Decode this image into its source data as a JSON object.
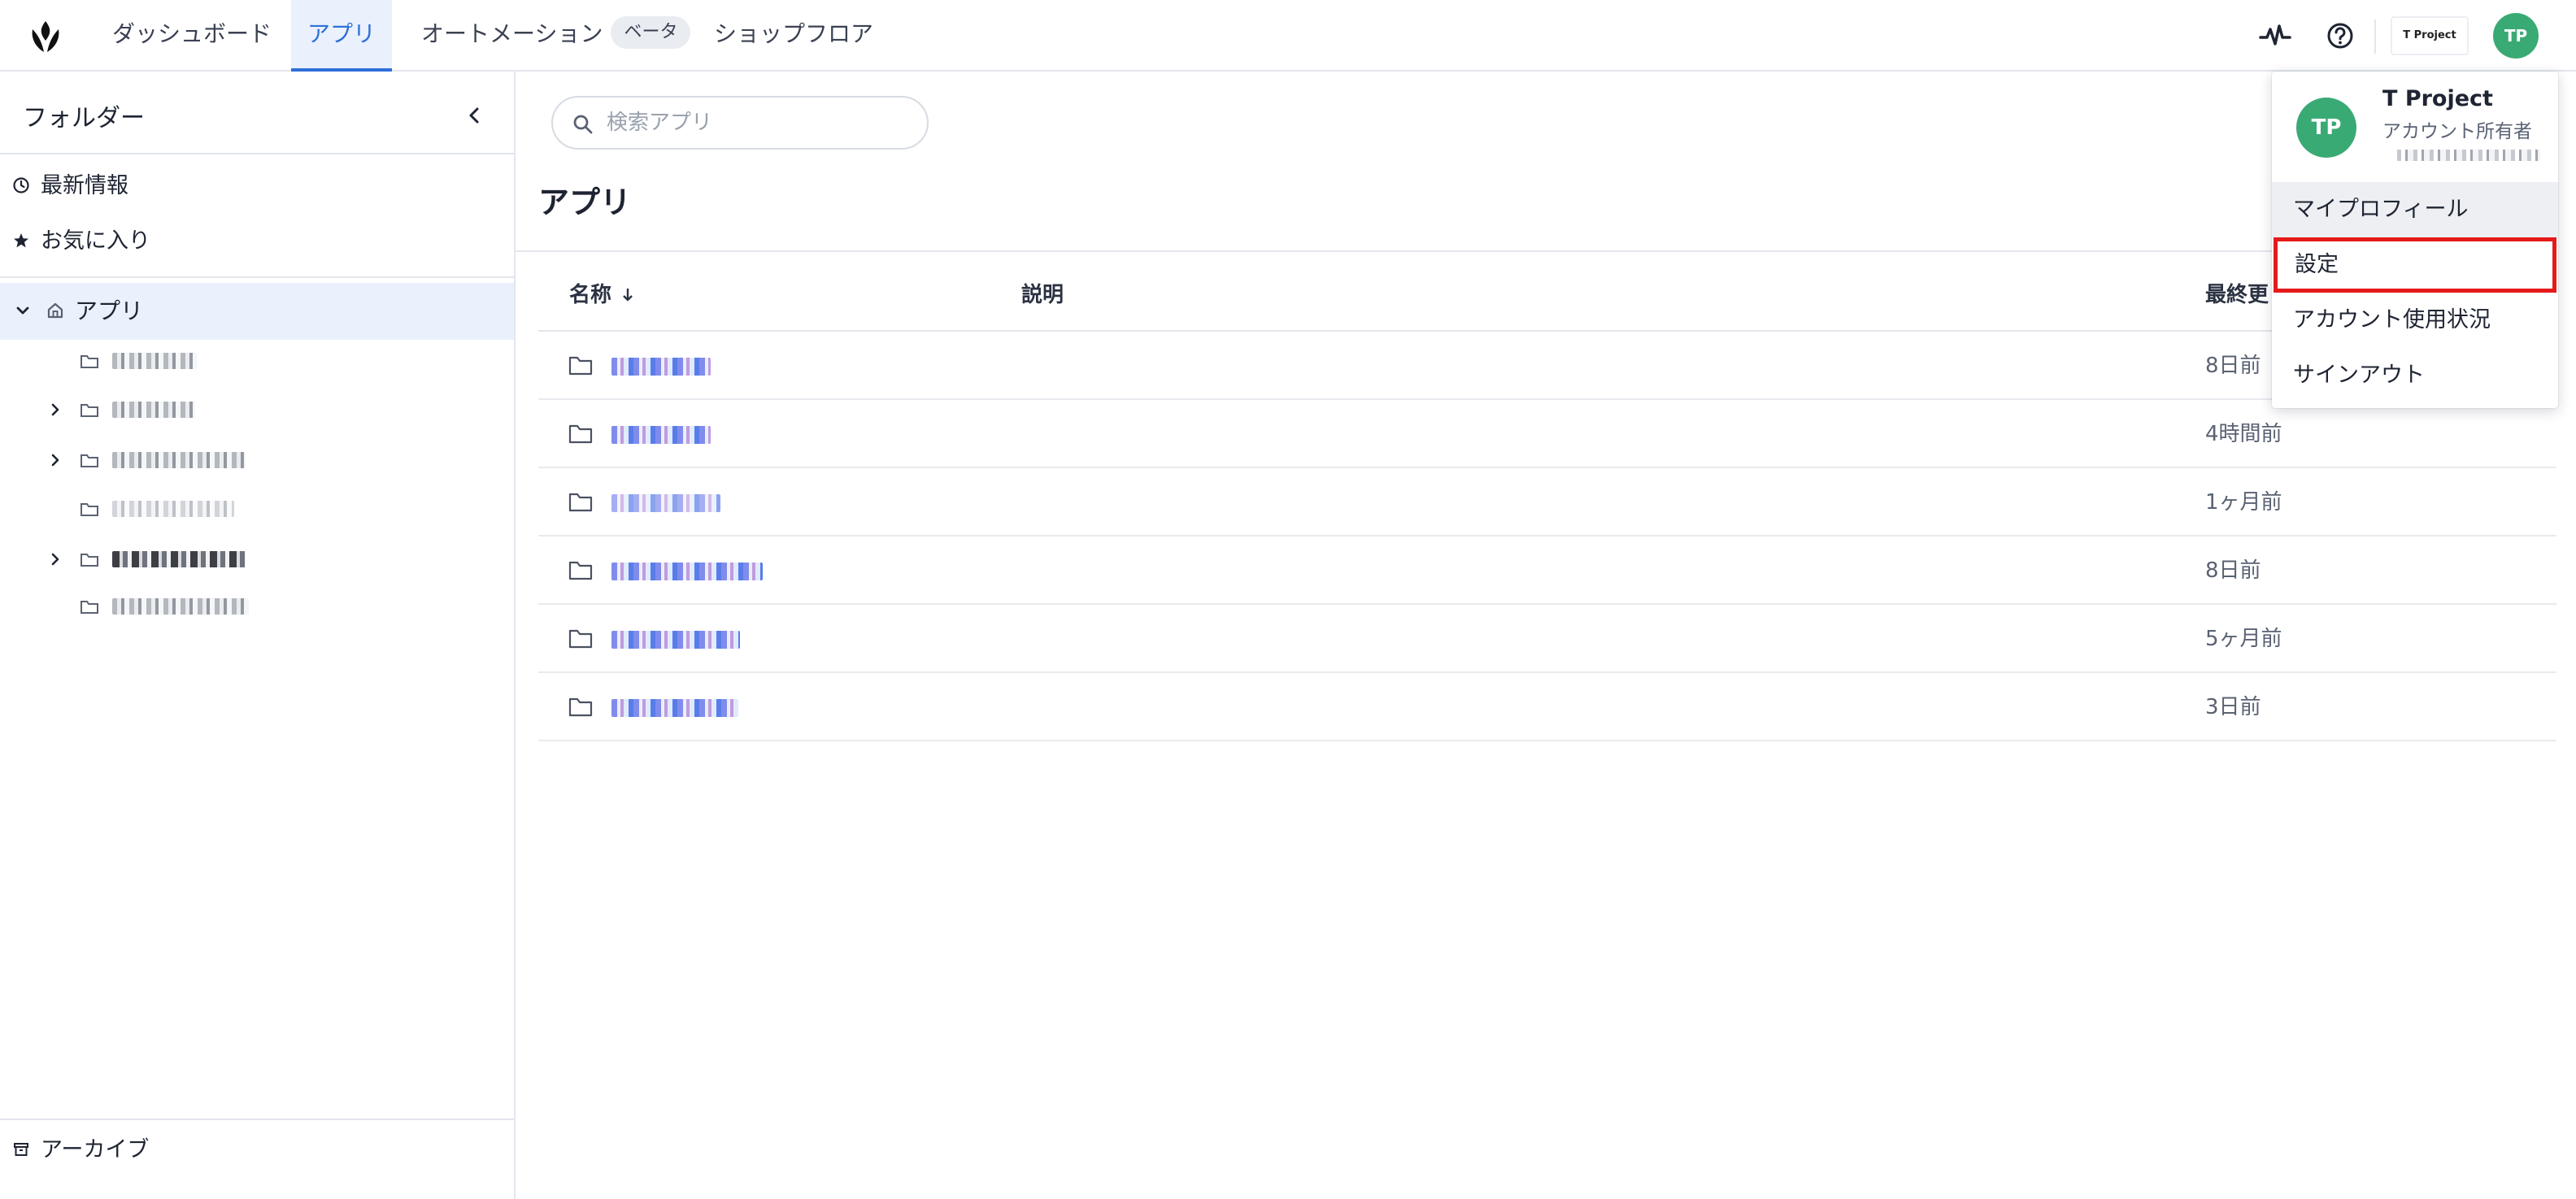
{
  "topbar": {
    "nav": [
      {
        "label": "ダッシュボード"
      },
      {
        "label": "アプリ",
        "active": true
      },
      {
        "label": "オートメーション",
        "badge": "ベータ"
      },
      {
        "label": "ショップフロア"
      }
    ],
    "brand_chip": "T Project",
    "avatar_initials": "TP"
  },
  "sidebar": {
    "title": "フォルダー",
    "links": [
      {
        "label": "最新情報",
        "icon": "clock-icon"
      },
      {
        "label": "お気に入り",
        "icon": "star-icon"
      }
    ],
    "apps_label": "アプリ",
    "archive_label": "アーカイブ"
  },
  "main": {
    "search_placeholder": "検索アプリ",
    "title": "アプリ",
    "columns": {
      "name": "名称",
      "description": "説明",
      "updated": "最終更"
    },
    "rows": [
      {
        "updated": "8日前"
      },
      {
        "updated": "4時間前"
      },
      {
        "updated": "1ヶ月前"
      },
      {
        "updated": "8日前"
      },
      {
        "updated": "5ヶ月前"
      },
      {
        "updated": "3日前"
      }
    ]
  },
  "account_menu": {
    "avatar_initials": "TP",
    "name": "T Project",
    "role": "アカウント所有者",
    "items": [
      {
        "label": "マイプロフィール"
      },
      {
        "label": "設定"
      },
      {
        "label": "アカウント使用状況"
      },
      {
        "label": "サインアウト"
      }
    ]
  },
  "colors": {
    "accent": "#2f6fd8",
    "avatar": "#3aaa75",
    "highlight": "#e51b1b",
    "active_bg": "#eaf1fc"
  }
}
